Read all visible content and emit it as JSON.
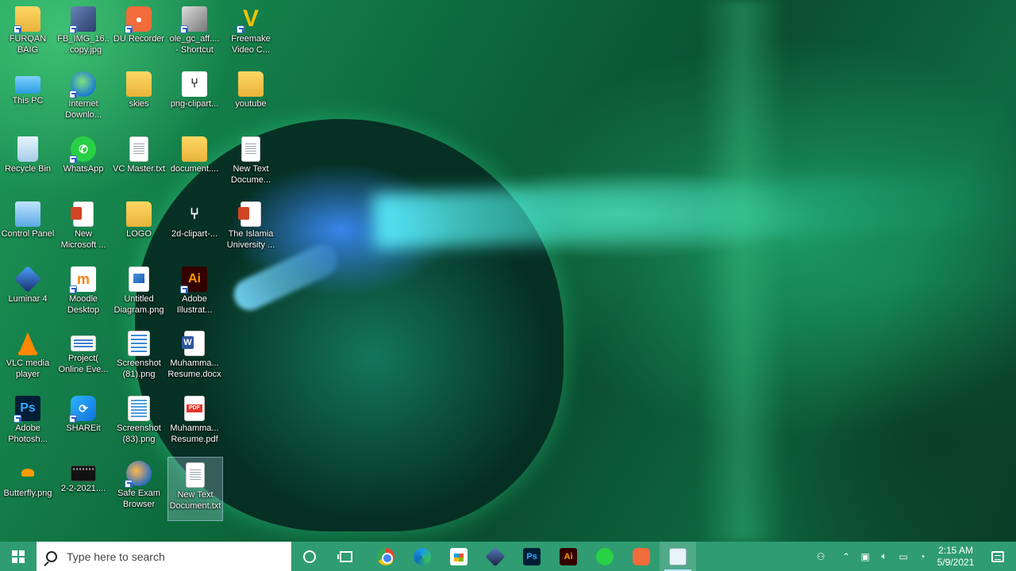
{
  "desktop": {
    "icons": [
      {
        "label": "FURQAN BAIG",
        "icon": "folder-icon"
      },
      {
        "label": "FB_IMG_16... copy.jpg",
        "icon": "photo-icon"
      },
      {
        "label": "DU Recorder",
        "icon": "du-recorder-icon"
      },
      {
        "label": "ole_gc_aff.... - Shortcut",
        "icon": "photo-icon"
      },
      {
        "label": "Freemake Video C...",
        "icon": "freemake-icon"
      },
      {
        "label": "This PC",
        "icon": "this-pc-icon"
      },
      {
        "label": "Internet Downlo...",
        "icon": "internet-download-manager-icon"
      },
      {
        "label": "skies",
        "icon": "folder-icon"
      },
      {
        "label": "png-clipart...",
        "icon": "image-icon"
      },
      {
        "label": "youtube",
        "icon": "folder-icon"
      },
      {
        "label": "Recycle Bin",
        "icon": "recycle-bin-icon"
      },
      {
        "label": "WhatsApp",
        "icon": "whatsapp-icon"
      },
      {
        "label": "VC Master.txt",
        "icon": "text-document-icon"
      },
      {
        "label": "document....",
        "icon": "folder-icon"
      },
      {
        "label": "New Text Docume...",
        "icon": "text-document-icon"
      },
      {
        "label": "Control Panel",
        "icon": "control-panel-icon"
      },
      {
        "label": "New Microsoft ...",
        "icon": "powerpoint-icon"
      },
      {
        "label": "LOGO",
        "icon": "folder-icon"
      },
      {
        "label": "2d-clipart-...",
        "icon": "image-icon"
      },
      {
        "label": "The Islamia University ...",
        "icon": "powerpoint-icon"
      },
      {
        "label": "Luminar 4",
        "icon": "luminar-icon"
      },
      {
        "label": "Moodle Desktop",
        "icon": "moodle-icon"
      },
      {
        "label": "Untitled Diagram.png",
        "icon": "image-icon"
      },
      {
        "label": "Adobe Illustrat...",
        "icon": "illustrator-icon"
      },
      {
        "label": "VLC media player",
        "icon": "vlc-icon"
      },
      {
        "label": "Project( Online Eve...",
        "icon": "project-icon"
      },
      {
        "label": "Screenshot (81).png",
        "icon": "screenshot-icon"
      },
      {
        "label": "Muhamma... Resume.docx",
        "icon": "word-icon"
      },
      {
        "label": "Adobe Photosh...",
        "icon": "photoshop-icon"
      },
      {
        "label": "SHAREit",
        "icon": "shareit-icon"
      },
      {
        "label": "Screenshot (83).png",
        "icon": "screenshot-icon"
      },
      {
        "label": "Muhamma... Resume.pdf",
        "icon": "pdf-icon"
      },
      {
        "label": "Butterfly.png",
        "icon": "butterfly-icon"
      },
      {
        "label": "2-2-2021....",
        "icon": "video-icon"
      },
      {
        "label": "Safe Exam Browser",
        "icon": "safe-exam-browser-icon"
      },
      {
        "label": "New Text Document.txt",
        "icon": "text-document-icon"
      }
    ]
  },
  "taskbar": {
    "search_placeholder": "Type here to search",
    "pinned_apps": [
      "Google Chrome",
      "Microsoft Edge",
      "Microsoft Store",
      "Luminar 4",
      "Adobe Photoshop",
      "Adobe Illustrator",
      "WhatsApp",
      "DU Recorder",
      "Notepad"
    ],
    "app_glyphs": {
      "photoshop": "Ps",
      "illustrator": "Ai"
    },
    "clock": {
      "time": "2:15 AM",
      "date": "5/9/2021"
    }
  }
}
